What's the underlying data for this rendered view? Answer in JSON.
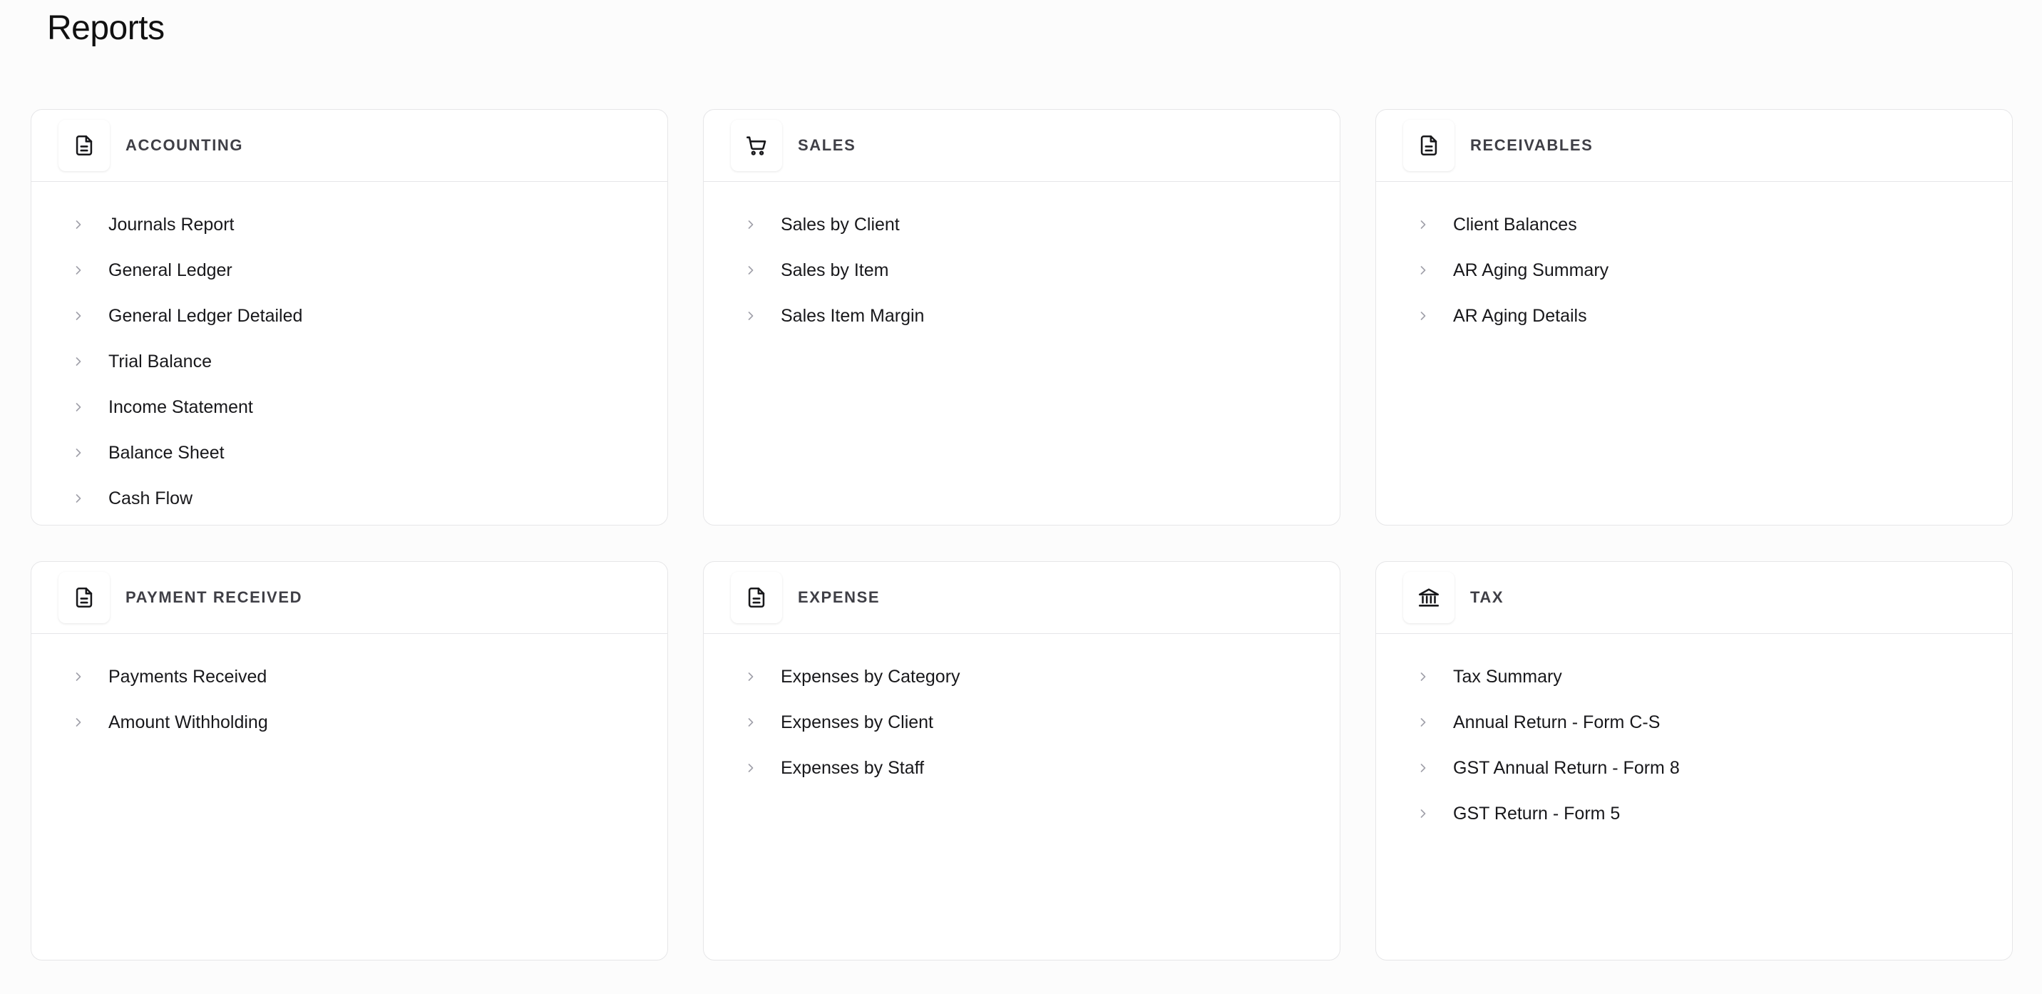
{
  "page": {
    "title": "Reports"
  },
  "colors": {
    "background": "#fcfcfc",
    "card_border": "#e6e6e8",
    "chevron": "#a1a1aa",
    "text": "#18181b"
  },
  "sections": [
    {
      "title": "ACCOUNTING",
      "icon": "document-icon",
      "items": [
        "Journals Report",
        "General Ledger",
        "General Ledger Detailed",
        "Trial Balance",
        "Income Statement",
        "Balance Sheet",
        "Cash Flow"
      ]
    },
    {
      "title": "SALES",
      "icon": "cart-icon",
      "items": [
        "Sales by Client",
        "Sales by Item",
        "Sales Item Margin"
      ]
    },
    {
      "title": "RECEIVABLES",
      "icon": "document-icon",
      "items": [
        "Client Balances",
        "AR Aging Summary",
        "AR Aging Details"
      ]
    },
    {
      "title": "PAYMENT RECEIVED",
      "icon": "document-icon",
      "items": [
        "Payments Received",
        "Amount Withholding"
      ]
    },
    {
      "title": "EXPENSE",
      "icon": "document-icon",
      "items": [
        "Expenses by Category",
        "Expenses by Client",
        "Expenses by Staff"
      ]
    },
    {
      "title": "TAX",
      "icon": "bank-icon",
      "items": [
        "Tax Summary",
        "Annual Return - Form C-S",
        "GST Annual Return - Form 8",
        "GST Return - Form 5"
      ]
    }
  ]
}
